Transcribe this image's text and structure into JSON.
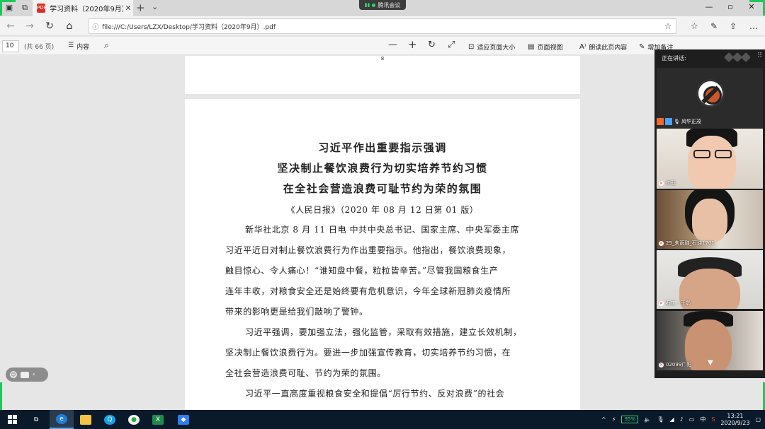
{
  "browser": {
    "tab_title": "学习资料（2020年9月）",
    "url": "file:///C:/Users/LZX/Desktop/学习资料（2020年9月）.pdf",
    "meeting_app": "腾讯会议"
  },
  "pdf_toolbar": {
    "current_page": "10",
    "total_pages": "(共 66 页)",
    "toc_label": "内容",
    "fit_page_label": "适应页面大小",
    "page_view_label": "页面视图",
    "read_aloud_label": "朗读此页内容",
    "add_notes_label": "增加备注"
  },
  "document": {
    "prev_page_number": "8",
    "headline_1": "习近平作出重要指示强调",
    "headline_2": "坚决制止餐饮浪费行为切实培养节约习惯",
    "headline_3": "在全社会营造浪费可耻节约为荣的氛围",
    "source": "《人民日报》（2020 年 08 月 12 日第 01 版）",
    "lines": [
      "新华社北京 8 月 11 日电  中共中央总书记、国家主席、中央军委主席",
      "习近平近日对制止餐饮浪费行为作出重要指示。他指出，餐饮浪费现象，",
      "触目惊心、令人痛心！“谁知盘中餐，粒粒皆辛苦。”尽管我国粮食生产",
      "连年丰收，对粮食安全还是始终要有危机意识，今年全球新冠肺炎疫情所",
      "带来的影响更是给我们敲响了警钟。",
      "习近平强调，要加强立法，强化监管，采取有效措施，建立长效机制，",
      "坚决制止餐饮浪费行为。要进一步加强宣传教育，切实培养节约习惯，在",
      "全社会营造浪费可耻、节约为荣的氛围。",
      "习近平一直高度重视粮食安全和提倡“厉行节约、反对浪费”的社会"
    ]
  },
  "meeting": {
    "speaking_label": "正在讲话:",
    "participants": [
      "风华正茂",
      "帅既",
      "25_朱雨璐_石油1701",
      "石工 - 王彰",
      "02099广阳"
    ]
  },
  "taskbar": {
    "battery": "95%",
    "ime": "中",
    "time": "13:21",
    "date": "2020/9/23"
  }
}
